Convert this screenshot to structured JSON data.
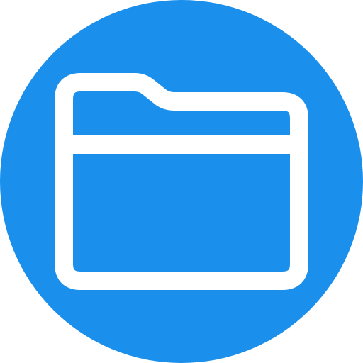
{
  "icon": {
    "name": "folder-icon",
    "background_shape": "circle",
    "colors": {
      "background": "#1a8fec",
      "stroke": "#ffffff"
    }
  }
}
